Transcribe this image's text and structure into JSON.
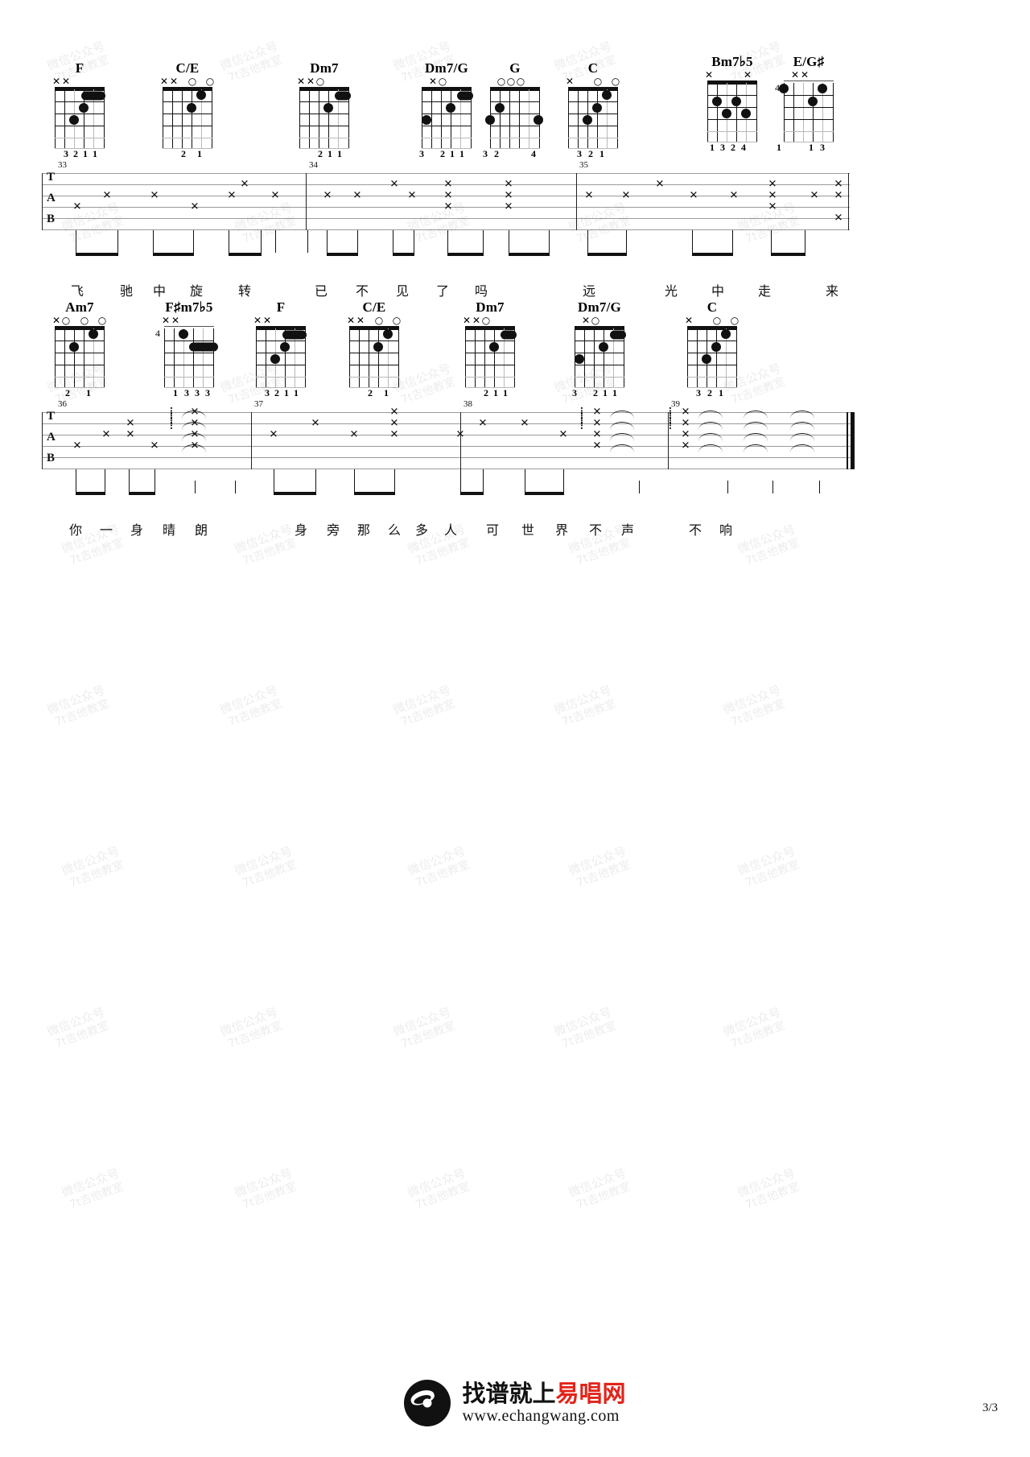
{
  "document": {
    "page_label": "3/3",
    "footer": {
      "brand_prefix": "找谱就上",
      "brand_accent": "易唱网",
      "website": "www.echangwang.com"
    },
    "watermark": {
      "line1": "微信公众号",
      "line2": "7t吉他教室"
    }
  },
  "systems": [
    {
      "id": "system-1",
      "tab_letters": [
        "T",
        "A",
        "B"
      ],
      "measure_numbers": [
        "33",
        "34",
        "35"
      ],
      "chords": [
        {
          "name": "F",
          "markers": "××",
          "fingers": "3 2 1 1",
          "fret": ""
        },
        {
          "name": "C/E",
          "markers": "××  O  O",
          "fingers": "2 1",
          "fret": ""
        },
        {
          "name": "Dm7",
          "markers": "××O",
          "fingers": "2 1 1",
          "fret": ""
        },
        {
          "name": "Dm7/G",
          "markers": "×O",
          "fingers": "3  2 1 1",
          "fret": ""
        },
        {
          "name": "G",
          "markers": "OOO",
          "fingers": "3 2      4",
          "fret": ""
        },
        {
          "name": "C",
          "markers": "×  O  O",
          "fingers": "3 2 1",
          "fret": ""
        },
        {
          "name": "Bm7♭5",
          "markers": "×   ×",
          "fingers": "1 3 2 4",
          "fret": ""
        },
        {
          "name": "E/G♯",
          "markers": "××",
          "fingers": "1  3",
          "fret": "4"
        }
      ],
      "lyrics": [
        "飞",
        "驰",
        "中",
        "旋",
        "转",
        "已",
        "不",
        "见",
        "了",
        "吗",
        "远",
        "光",
        "中",
        "走",
        "来"
      ]
    },
    {
      "id": "system-2",
      "tab_letters": [
        "T",
        "A",
        "B"
      ],
      "measure_numbers": [
        "36",
        "37",
        "38",
        "39"
      ],
      "chords": [
        {
          "name": "Am7",
          "markers": "×O  O   O",
          "fingers": "2  1",
          "fret": ""
        },
        {
          "name": "F♯m7♭5",
          "markers": "××",
          "fingers": "1 3 3 3",
          "fret": "4"
        },
        {
          "name": "F",
          "markers": "××",
          "fingers": "3 2 1 1",
          "fret": ""
        },
        {
          "name": "C/E",
          "markers": "××  O  O",
          "fingers": "2 1",
          "fret": ""
        },
        {
          "name": "Dm7",
          "markers": "××O",
          "fingers": "2 1 1",
          "fret": ""
        },
        {
          "name": "Dm7/G",
          "markers": "×O",
          "fingers": "3  2 1 1",
          "fret": ""
        },
        {
          "name": "C",
          "markers": "×  O  O",
          "fingers": "3 2 1",
          "fret": ""
        }
      ],
      "lyrics": [
        "你",
        "一",
        "身",
        "晴",
        "朗",
        "身",
        "旁",
        "那",
        "么",
        "多",
        "人",
        "可",
        "世",
        "界",
        "不",
        "声",
        "不",
        "响"
      ]
    }
  ]
}
